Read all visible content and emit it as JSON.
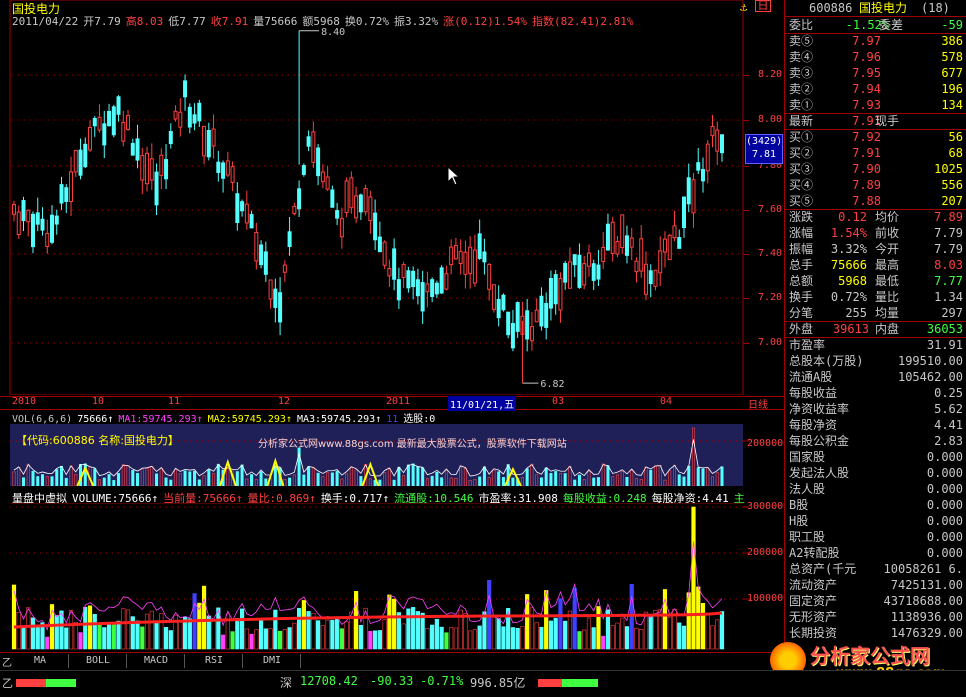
{
  "title": "国投电力",
  "sidebar_header": {
    "code": "600886",
    "name": "国投电力",
    "count": "(18)"
  },
  "info_line": [
    {
      "t": "2011/04/22",
      "c": "#c8c8c8"
    },
    {
      "t": "开7.79",
      "c": "#c8c8c8"
    },
    {
      "t": "高8.03",
      "c": "#ff4040"
    },
    {
      "t": "低7.77",
      "c": "#c8c8c8"
    },
    {
      "t": "收7.91",
      "c": "#ff4040"
    },
    {
      "t": "量75666",
      "c": "#c8c8c8"
    },
    {
      "t": "额5968",
      "c": "#c8c8c8"
    },
    {
      "t": "换0.72%",
      "c": "#c8c8c8"
    },
    {
      "t": "振3.32%",
      "c": "#c8c8c8"
    },
    {
      "t": "涨(0.12)1.54%",
      "c": "#ff4040"
    },
    {
      "t": "指数(82.41)2.81%",
      "c": "#ff4040"
    }
  ],
  "price_axis": [
    "8.20",
    "8.00",
    "7.80",
    "7.60",
    "7.40",
    "7.20",
    "7.00"
  ],
  "high_label": "8.40",
  "low_label": "6.82",
  "cursor_box": {
    "top": "(3429)",
    "bottom": "7.81"
  },
  "date_axis": [
    "2010",
    "10",
    "11",
    "12",
    "2011",
    "11/01/21,五",
    "03",
    "04",
    "日线"
  ],
  "vol_legend": [
    {
      "t": "VOL(6,6,6)",
      "c": "#c8c8c8"
    },
    {
      "t": "75666↑",
      "c": "#ffffff"
    },
    {
      "t": "MA1:59745.293↑",
      "c": "#ff40ff"
    },
    {
      "t": "MA2:59745.293↑",
      "c": "#ffff00"
    },
    {
      "t": "MA3:59745.293↑",
      "c": "#ffffff"
    },
    {
      "t": "11",
      "c": "#4040ff"
    },
    {
      "t": "选股:0",
      "c": "#ffffff"
    }
  ],
  "vol_banner": {
    "left": "【代码:600886 名称:国投电力】",
    "right": "分析家公式网www.88gs.com 最新最大股票公式，股票软件下载网站"
  },
  "vol_axis": [
    "200000"
  ],
  "ind_legend": [
    {
      "t": "量盘中虚拟",
      "c": "#ffffff"
    },
    {
      "t": "VOLUME:75666↑",
      "c": "#ffffff"
    },
    {
      "t": "当前量:75666↑",
      "c": "#ff4040"
    },
    {
      "t": "量比:0.869↑",
      "c": "#ff4040"
    },
    {
      "t": "换手:0.717↑",
      "c": "#ffffff"
    },
    {
      "t": "流通股:10.546",
      "c": "#40ff40"
    },
    {
      "t": "市盈率:31.908",
      "c": "#ffffff"
    },
    {
      "t": "每股收益:0.248",
      "c": "#40ff40"
    },
    {
      "t": "每股净资:4.41",
      "c": "#ffffff"
    },
    {
      "t": "主",
      "c": "#40ff40"
    }
  ],
  "ind_axis": [
    "300000",
    "200000",
    "100000"
  ],
  "order_book": {
    "ratio": {
      "label1": "委比",
      "val1": "-1.52%",
      "label2": "委差",
      "val2": "-59"
    },
    "sells": [
      {
        "label": "卖⑤",
        "price": "7.97",
        "vol": "386"
      },
      {
        "label": "卖④",
        "price": "7.96",
        "vol": "578"
      },
      {
        "label": "卖③",
        "price": "7.95",
        "vol": "677"
      },
      {
        "label": "卖②",
        "price": "7.94",
        "vol": "196"
      },
      {
        "label": "卖①",
        "price": "7.93",
        "vol": "134"
      }
    ],
    "latest": {
      "label": "最新",
      "price": "7.91",
      "note": "现手"
    },
    "buys": [
      {
        "label": "买①",
        "price": "7.92",
        "vol": "56"
      },
      {
        "label": "买②",
        "price": "7.91",
        "vol": "68"
      },
      {
        "label": "买③",
        "price": "7.90",
        "vol": "1025"
      },
      {
        "label": "买④",
        "price": "7.89",
        "vol": "556"
      },
      {
        "label": "买⑤",
        "price": "7.88",
        "vol": "207"
      }
    ]
  },
  "stats": [
    {
      "l1": "涨跌",
      "v1": "0.12",
      "c1": "#ff4040",
      "l2": "均价",
      "v2": "7.89",
      "c2": "#ff4040"
    },
    {
      "l1": "涨幅",
      "v1": "1.54%",
      "c1": "#ff4040",
      "l2": "前收",
      "v2": "7.79",
      "c2": "#c8c8c8"
    },
    {
      "l1": "振幅",
      "v1": "3.32%",
      "c1": "#c8c8c8",
      "l2": "今开",
      "v2": "7.79",
      "c2": "#c8c8c8"
    },
    {
      "l1": "总手",
      "v1": "75666",
      "c1": "#ffff00",
      "l2": "最高",
      "v2": "8.03",
      "c2": "#ff4040"
    },
    {
      "l1": "总额",
      "v1": "5968",
      "c1": "#ffff00",
      "l2": "最低",
      "v2": "7.77",
      "c2": "#40ff40"
    },
    {
      "l1": "换手",
      "v1": "0.72%",
      "c1": "#c8c8c8",
      "l2": "量比",
      "v2": "1.34",
      "c2": "#c8c8c8"
    },
    {
      "l1": "分笔",
      "v1": "255",
      "c1": "#c8c8c8",
      "l2": "均量",
      "v2": "297",
      "c2": "#c8c8c8"
    }
  ],
  "inner_outer": {
    "l1": "外盘",
    "v1": "39613",
    "l2": "内盘",
    "v2": "36053"
  },
  "fundamentals": [
    {
      "l": "市盈率",
      "v": "31.91"
    },
    {
      "l": "总股本(万股)",
      "v": "199510.00"
    },
    {
      "l": "流通A股",
      "v": "105462.00"
    },
    {
      "l": "每股收益",
      "v": "0.25"
    },
    {
      "l": "净资收益率",
      "v": "5.62"
    },
    {
      "l": "每股净资",
      "v": "4.41"
    },
    {
      "l": "每股公积金",
      "v": "2.83"
    },
    {
      "l": "国家股",
      "v": "0.000"
    },
    {
      "l": "发起法人股",
      "v": "0.000"
    },
    {
      "l": "法人股",
      "v": "0.000"
    },
    {
      "l": "B股",
      "v": "0.000"
    },
    {
      "l": "H股",
      "v": "0.000"
    },
    {
      "l": "职工股",
      "v": "0.000"
    },
    {
      "l": "A2转配股",
      "v": "0.000"
    },
    {
      "l": "总资产(千元",
      "v": "10058261 6."
    },
    {
      "l": "流动资产",
      "v": "7425131.00"
    },
    {
      "l": "固定资产",
      "v": "43718688.00"
    },
    {
      "l": "无形资产",
      "v": "1138936.00"
    },
    {
      "l": "长期投资",
      "v": "1476329.00"
    }
  ],
  "tabs": [
    "MA",
    "BOLL",
    "MACD",
    "RSI",
    "DMI"
  ],
  "status": {
    "index_name": "深",
    "index_val": "12708.42",
    "change": "-90.33",
    "pct": "-0.71%",
    "amount": "996.85亿"
  },
  "watermark": {
    "cn": "分析家公式网",
    "url": "www.88gs.com"
  },
  "colors": {
    "up": "#ff4040",
    "down": "#54ffff",
    "grid": "#a00000",
    "yellow": "#ffff00"
  },
  "chart_data": {
    "type": "candlestick",
    "x": [
      "2010",
      "10",
      "11",
      "12",
      "2011",
      "03",
      "04"
    ],
    "ylim": [
      6.82,
      8.4
    ],
    "last_close": 7.91,
    "high": 8.4,
    "low": 6.82
  }
}
